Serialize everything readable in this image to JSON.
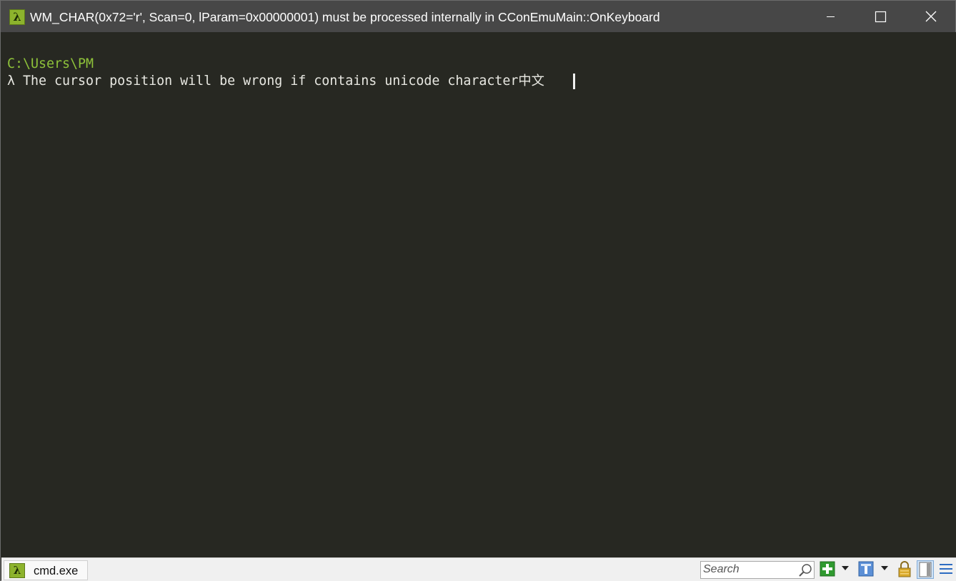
{
  "window": {
    "title": "WM_CHAR(0x72='r', Scan=0, lParam=0x00000001) must be processed internally in CConEmuMain::OnKeyboard",
    "app_icon_glyph": "λ"
  },
  "console": {
    "path_line": "C:\\Users\\PM",
    "command_line": "λ The cursor position will be wrong if contains unicode character中文",
    "path_color": "#8ec23a",
    "text_color": "#e8e8e2",
    "background": "#272822"
  },
  "statusbar": {
    "tab": {
      "icon_glyph": "λ",
      "label": "cmd.exe"
    },
    "search": {
      "placeholder": "Search"
    },
    "icons": [
      "new-console-icon",
      "dropdown-arrow-icon",
      "paste-icon",
      "dropdown-arrow-icon",
      "lock-icon",
      "split-view-icon",
      "menu-icon"
    ]
  }
}
